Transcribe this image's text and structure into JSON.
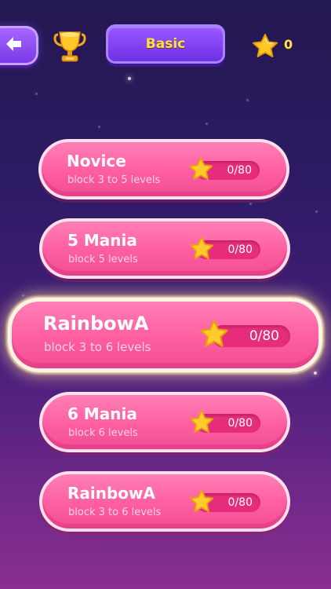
{
  "header": {
    "back_icon": "back-arrow-icon",
    "trophy_icon": "trophy-icon",
    "mode_label": "Basic",
    "star_total": "0",
    "star_icon": "star-icon"
  },
  "levels": [
    {
      "title": "Novice",
      "subtitle": "block 3 to 5 levels",
      "progress": "0/80",
      "selected": false
    },
    {
      "title": "5 Mania",
      "subtitle": "block 5 levels",
      "progress": "0/80",
      "selected": false
    },
    {
      "title": "RainbowA",
      "subtitle": "block 3 to 6 levels",
      "progress": "0/80",
      "selected": true
    },
    {
      "title": "6 Mania",
      "subtitle": "block 6 levels",
      "progress": "0/80",
      "selected": false
    },
    {
      "title": "RainbowA",
      "subtitle": "block 3 to 6 levels",
      "progress": "0/80",
      "selected": false
    }
  ],
  "colors": {
    "card_pink": "#ff5ea1",
    "pill_pink": "#e62d7c",
    "button_purple": "#7a39e6",
    "accent_yellow": "#ffe14a"
  }
}
